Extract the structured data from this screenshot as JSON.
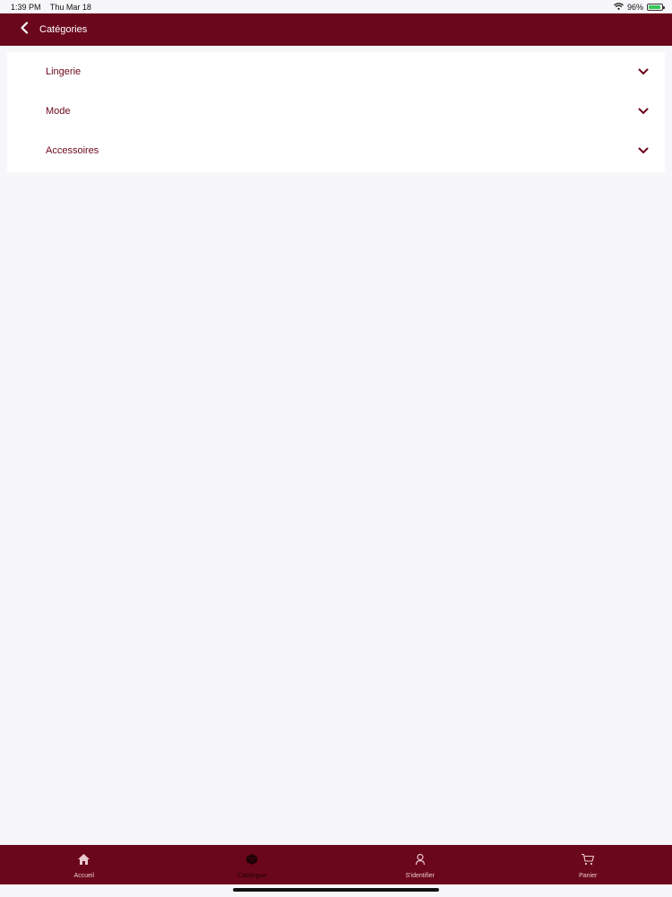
{
  "status_bar": {
    "time": "1:39 PM",
    "date": "Thu Mar 18",
    "battery": "96%",
    "battery_level": 0.96
  },
  "nav": {
    "title": "Catégories",
    "back_icon": "chevron-left-icon"
  },
  "categories": [
    {
      "label": "Lingerie",
      "icon": "chevron-down-icon"
    },
    {
      "label": "Mode",
      "icon": "chevron-down-icon"
    },
    {
      "label": "Accessoires",
      "icon": "chevron-down-icon"
    }
  ],
  "tabs": [
    {
      "label": "Accueil",
      "icon": "home-icon",
      "active": false
    },
    {
      "label": "Catalogue",
      "icon": "cube-icon",
      "active": true
    },
    {
      "label": "S'identifier",
      "icon": "user-icon",
      "active": false
    },
    {
      "label": "Panier",
      "icon": "cart-icon",
      "active": false
    }
  ],
  "colors": {
    "brand": "#6b071c",
    "background": "#f7f7f9",
    "card": "#ffffff"
  }
}
